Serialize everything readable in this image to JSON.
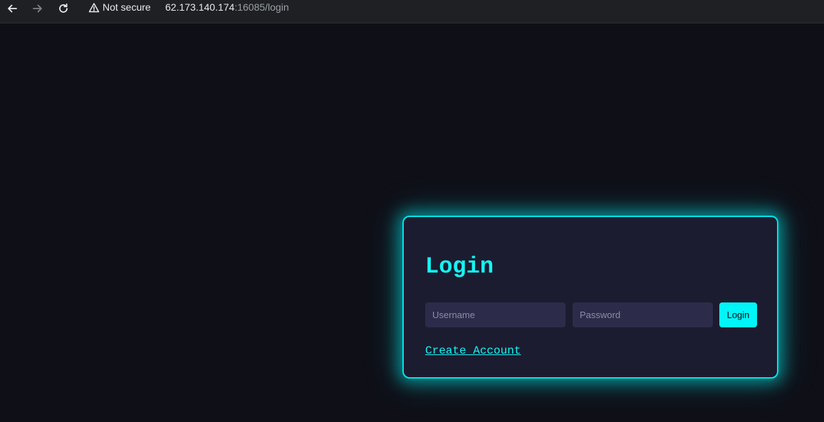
{
  "browser": {
    "not_secure_label": "Not secure",
    "url_host": "62.173.140.174",
    "url_rest": ":16085/login"
  },
  "login": {
    "title": "Login",
    "username_placeholder": "Username",
    "username_value": "",
    "password_placeholder": "Password",
    "password_value": "",
    "submit_label": "Login",
    "create_account_label": "Create Account"
  },
  "colors": {
    "accent": "#00f5f8",
    "card_background": "#1c1c30",
    "page_background": "#0f0f17",
    "input_background": "#2c2c4a"
  },
  "icons": {
    "back": "arrow-left-icon",
    "forward": "arrow-right-icon",
    "reload": "reload-icon",
    "security": "warning-triangle-icon"
  }
}
